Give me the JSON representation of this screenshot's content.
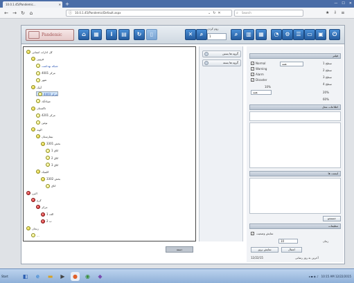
{
  "browser": {
    "tab_title": "10.0.1.45/Pandemic...",
    "url": "10.0.1.45/Pandemic/Default.aspx",
    "search_placeholder": "Search"
  },
  "app": {
    "logo_text": "Pandemic",
    "zoom_label": "زوم کردن",
    "zoom_value": "1"
  },
  "tree": [
    {
      "label": "کل ادارات استانی",
      "depth": 0,
      "color": "g",
      "link": false
    },
    {
      "label": "قزوین",
      "depth": 1,
      "color": "g",
      "link": false
    },
    {
      "label": "شبکه بهداشت",
      "depth": 2,
      "color": "y",
      "link": true
    },
    {
      "label": "مرکز 4001",
      "depth": 2,
      "color": "y",
      "link": false
    },
    {
      "label": "شهر",
      "depth": 2,
      "color": "y",
      "link": false
    },
    {
      "label": "آبیک",
      "depth": 1,
      "color": "g",
      "link": false
    },
    {
      "label": "مرکز 4403",
      "depth": 2,
      "color": "y",
      "link": true,
      "selected": true
    },
    {
      "label": "ضیاءآباد",
      "depth": 2,
      "color": "y",
      "link": false
    },
    {
      "label": "تاکستان",
      "depth": 1,
      "color": "g",
      "link": false
    },
    {
      "label": "مرکز 4201",
      "depth": 2,
      "color": "y",
      "link": false
    },
    {
      "label": "بوئین",
      "depth": 2,
      "color": "y",
      "link": false
    },
    {
      "label": "الوند",
      "depth": 1,
      "color": "g",
      "link": false
    },
    {
      "label": "بیمارستان",
      "depth": 2,
      "color": "g",
      "link": false
    },
    {
      "label": "بخش 3301",
      "depth": 3,
      "color": "g",
      "link": false
    },
    {
      "label": "اتاق 1",
      "depth": 4,
      "color": "y",
      "link": false
    },
    {
      "label": "اتاق 2",
      "depth": 4,
      "color": "y",
      "link": false
    },
    {
      "label": "اتاق 3",
      "depth": 4,
      "color": "y",
      "link": false
    },
    {
      "label": "کلینیک",
      "depth": 2,
      "color": "g",
      "link": false
    },
    {
      "label": "بخش 3302",
      "depth": 3,
      "color": "g",
      "link": false
    },
    {
      "label": "اتاق",
      "depth": 4,
      "color": "y",
      "link": false
    },
    {
      "label": "البرز",
      "depth": 0,
      "color": "r",
      "link": false
    },
    {
      "label": "کرج",
      "depth": 1,
      "color": "r",
      "link": false
    },
    {
      "label": "مرکز",
      "depth": 2,
      "color": "r",
      "link": false
    },
    {
      "label": "الف 1",
      "depth": 3,
      "color": "r",
      "link": false
    },
    {
      "label": "ب 2",
      "depth": 3,
      "color": "r",
      "link": false
    },
    {
      "label": "زنجان",
      "depth": 0,
      "color": "g",
      "link": false
    },
    {
      "label": "...",
      "depth": 1,
      "color": "y",
      "link": false
    }
  ],
  "mid": {
    "btn1": "گروه ها بستن",
    "btn2": "گروه ها بسته"
  },
  "right": {
    "header1": "فیلتر",
    "checks": [
      "Normal",
      "Warning",
      "Alarm",
      "Disaster"
    ],
    "sel1": "همه",
    "lbl_status1": "سطح 1",
    "lbl_status2": "سطح 2",
    "lbl_status3": "سطح 3",
    "lbl_status4": "سطح 4",
    "pct1": "10%",
    "pct2": "20%",
    "pct3": "60%",
    "header2": "اطلاعات محل",
    "header3": "لیست ها",
    "header4": "تنظیمات",
    "btn_search": "جستجو",
    "chk_show": "نمایش وضعیت",
    "sel_time": "10",
    "lbl_time": "زمان",
    "btn_apply": "اعمال",
    "btn_refresh": "نمایش بروز",
    "last_update_label": "آخرین به روز رسانی",
    "last_update_value": "12/22/15"
  },
  "status": {
    "chip": "دسته"
  },
  "taskbar": {
    "start": "Start",
    "clock": "10:15 AM",
    "date": "12/22/2015"
  }
}
